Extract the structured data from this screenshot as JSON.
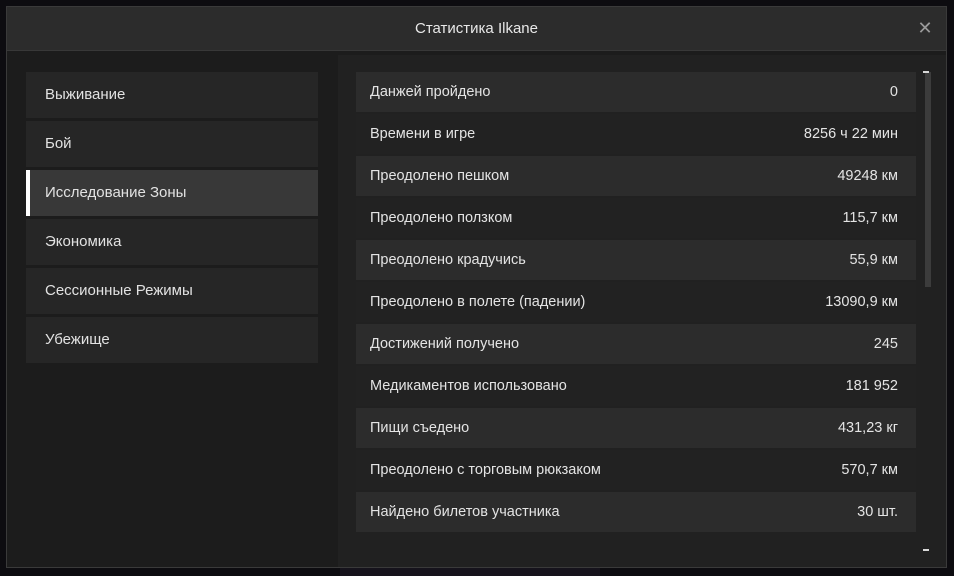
{
  "window": {
    "title": "Статистика Ilkane",
    "close_glyph": "✕"
  },
  "sidebar": {
    "items": [
      {
        "label": "Выживание",
        "active": false
      },
      {
        "label": "Бой",
        "active": false
      },
      {
        "label": "Исследование Зоны",
        "active": true
      },
      {
        "label": "Экономика",
        "active": false
      },
      {
        "label": "Сессионные Режимы",
        "active": false
      },
      {
        "label": "Убежище",
        "active": false
      }
    ]
  },
  "stats": [
    {
      "label": "Данжей пройдено",
      "value": "0"
    },
    {
      "label": "Времени в игре",
      "value": "8256 ч 22 мин"
    },
    {
      "label": "Преодолено пешком",
      "value": "49248 км"
    },
    {
      "label": "Преодолено ползком",
      "value": "115,7 км"
    },
    {
      "label": "Преодолено крадучись",
      "value": "55,9 км"
    },
    {
      "label": "Преодолено в полете (падении)",
      "value": "13090,9 км"
    },
    {
      "label": "Достижений получено",
      "value": "245"
    },
    {
      "label": "Медикаментов использовано",
      "value": "181 952"
    },
    {
      "label": "Пищи съедено",
      "value": "431,23 кг"
    },
    {
      "label": "Преодолено с торговым рюкзаком",
      "value": "570,7 км"
    },
    {
      "label": "Найдено билетов участника",
      "value": "30 шт."
    }
  ],
  "colors": {
    "accent": "#ffffff",
    "panel": "#212121",
    "row_alt": "#2c2c2c"
  }
}
